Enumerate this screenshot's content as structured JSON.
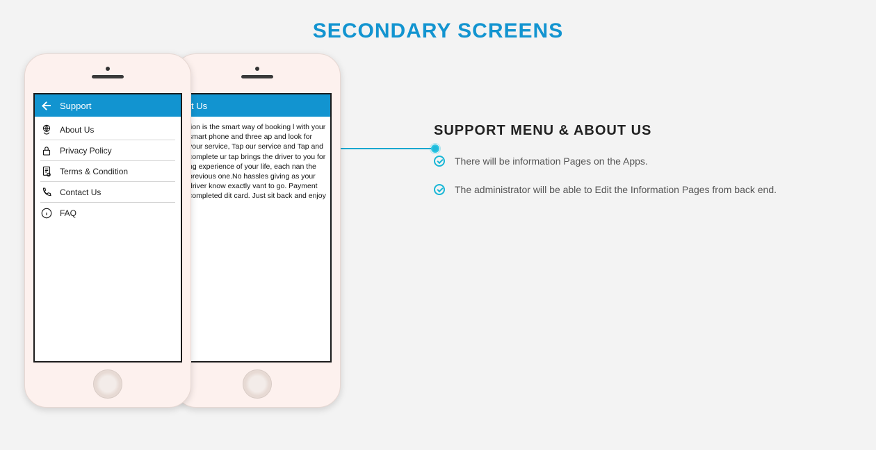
{
  "hero_title": "SECONDARY SCREENS",
  "details": {
    "heading": "SUPPORT MENU & ABOUT US",
    "features": [
      "There will be information Pages on the Apps.",
      "The administrator will be able to Edit the Information Pages from back end."
    ]
  },
  "phone_front": {
    "appbar_title": "Support",
    "menu": [
      {
        "label": "About Us",
        "icon": "globe-hand"
      },
      {
        "label": "Privacy Policy",
        "icon": "lock"
      },
      {
        "label": "Terms & Condition",
        "icon": "document"
      },
      {
        "label": "Contact Us",
        "icon": "phone"
      },
      {
        "label": "FAQ",
        "icon": "info"
      }
    ]
  },
  "phone_back": {
    "appbar_title_fragment": "t Us",
    "body_text": "tion is the smart way of booking l with your smart phone and three ap and look for your service, Tap our service and Tap and complete ur tap brings the driver to you for ng experience of your life, each nan the previous one.No hassles giving as your driver know exactly vant to go. Payment completed dit card. Just sit back and enjoy"
  }
}
